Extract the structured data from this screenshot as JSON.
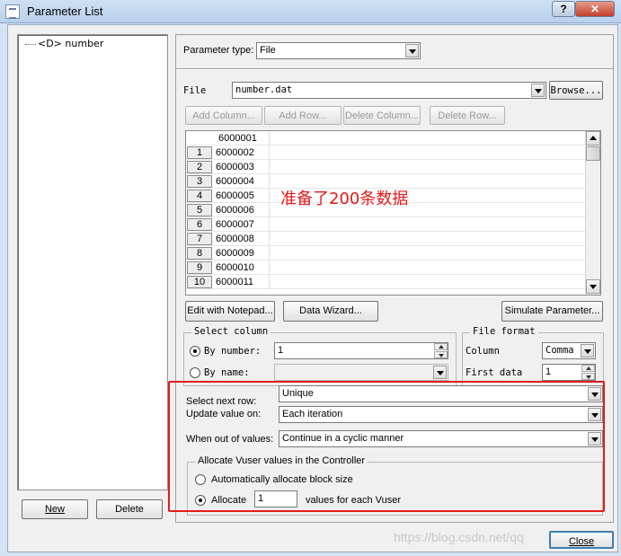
{
  "window": {
    "title": "Parameter List",
    "help_label": "?",
    "close_glyph": "✕"
  },
  "tree": {
    "item_icon": "<D>",
    "item_label": "number"
  },
  "buttons": {
    "new": "New",
    "delete": "Delete",
    "close": "Close"
  },
  "param": {
    "type_label": "Parameter type:",
    "type_value": "File"
  },
  "file": {
    "label": "File",
    "path": "number.dat",
    "browse": "Browse..."
  },
  "toolbar": {
    "add_column": "Add Column...",
    "add_row": "Add Row...",
    "delete_column": "Delete Column...",
    "delete_row": "Delete Row..."
  },
  "grid": {
    "header": "6000001",
    "rows": [
      {
        "n": "1",
        "v": "6000002"
      },
      {
        "n": "2",
        "v": "6000003"
      },
      {
        "n": "3",
        "v": "6000004"
      },
      {
        "n": "4",
        "v": "6000005"
      },
      {
        "n": "5",
        "v": "6000006"
      },
      {
        "n": "6",
        "v": "6000007"
      },
      {
        "n": "7",
        "v": "6000008"
      },
      {
        "n": "8",
        "v": "6000009"
      },
      {
        "n": "9",
        "v": "6000010"
      },
      {
        "n": "10",
        "v": "6000011"
      }
    ]
  },
  "annotation": "准备了200条数据",
  "actions": {
    "edit_notepad": "Edit with Notepad...",
    "data_wizard": "Data Wizard...",
    "simulate": "Simulate Parameter..."
  },
  "select_column": {
    "title": "Select column",
    "by_number": "By number:",
    "by_number_value": "1",
    "by_name": "By name:"
  },
  "file_format": {
    "title": "File format",
    "column_label": "Column",
    "column_value": "Comma",
    "first_data_label": "First data",
    "first_data_value": "1"
  },
  "next_row": {
    "label": "Select next row:",
    "value": "Unique"
  },
  "update_value": {
    "label": "Update value on:",
    "value": "Each iteration"
  },
  "out_of_values": {
    "label": "When out of values:",
    "value": "Continue in a cyclic manner"
  },
  "allocate": {
    "title": "Allocate Vuser values in the Controller",
    "auto": "Automatically allocate block size",
    "manual": "Allocate",
    "manual_value": "1",
    "suffix": "values for each Vuser"
  },
  "watermark": "https://blog.csdn.net/qq"
}
